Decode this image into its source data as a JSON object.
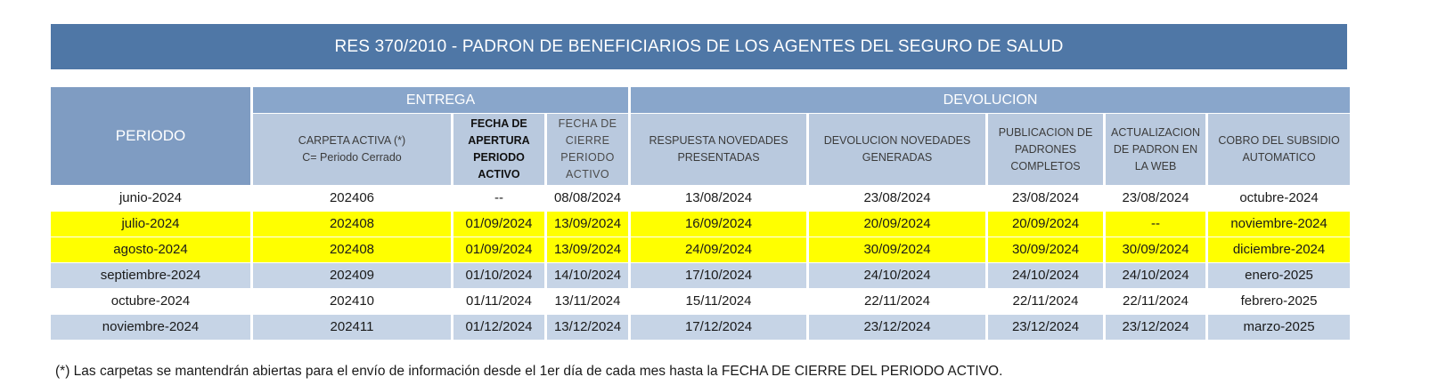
{
  "title": "RES 370/2010 - PADRON DE BENEFICIARIOS DE LOS AGENTES DEL SEGURO DE SALUD",
  "headers": {
    "periodo": "PERIODO",
    "entrega": "ENTREGA",
    "devolucion": "DEVOLUCION",
    "carpeta_activa_line1": "CARPETA ACTIVA (*)",
    "carpeta_activa_line2": "C= Periodo Cerrado",
    "fecha_apertura": "FECHA DE APERTURA PERIODO ACTIVO",
    "fecha_cierre": "FECHA DE CIERRE PERIODO ACTIVO",
    "respuesta_novedades": "RESPUESTA NOVEDADES PRESENTADAS",
    "devolucion_novedades": "DEVOLUCION NOVEDADES GENERADAS",
    "publicacion_padrones": "PUBLICACION DE PADRONES COMPLETOS",
    "actualizacion_padron": "ACTUALIZACION DE PADRON EN LA WEB",
    "cobro_subsidio": "COBRO DEL SUBSIDIO AUTOMATICO"
  },
  "rows": [
    {
      "style": "white",
      "cells": [
        "junio-2024",
        "202406",
        "--",
        "08/08/2024",
        "13/08/2024",
        "23/08/2024",
        "23/08/2024",
        "23/08/2024",
        "octubre-2024"
      ]
    },
    {
      "style": "yellow",
      "cells": [
        "julio-2024",
        "202408",
        "01/09/2024",
        "13/09/2024",
        "16/09/2024",
        "20/09/2024",
        "20/09/2024",
        "--",
        "noviembre-2024"
      ]
    },
    {
      "style": "yellow",
      "cells": [
        "agosto-2024",
        "202408",
        "01/09/2024",
        "13/09/2024",
        "24/09/2024",
        "30/09/2024",
        "30/09/2024",
        "30/09/2024",
        "diciembre-2024"
      ]
    },
    {
      "style": "blue",
      "cells": [
        "septiembre-2024",
        "202409",
        "01/10/2024",
        "14/10/2024",
        "17/10/2024",
        "24/10/2024",
        "24/10/2024",
        "24/10/2024",
        "enero-2025"
      ]
    },
    {
      "style": "white",
      "cells": [
        "octubre-2024",
        "202410",
        "01/11/2024",
        "13/11/2024",
        "15/11/2024",
        "22/11/2024",
        "22/11/2024",
        "22/11/2024",
        "febrero-2025"
      ]
    },
    {
      "style": "blue",
      "cells": [
        "noviembre-2024",
        "202411",
        "01/12/2024",
        "13/12/2024",
        "17/12/2024",
        "23/12/2024",
        "23/12/2024",
        "23/12/2024",
        "marzo-2025"
      ]
    }
  ],
  "footnote": "(*)  Las carpetas se mantendrán abiertas para el envío de información desde el 1er día de cada mes hasta la FECHA DE CIERRE DEL PERIODO ACTIVO.",
  "colors": {
    "banner": "#4f77a6",
    "header_group": "#89a6cb",
    "header_sub": "#b9c9de",
    "highlight_yellow": "#ffff00",
    "row_blue": "#c6d4e6"
  }
}
